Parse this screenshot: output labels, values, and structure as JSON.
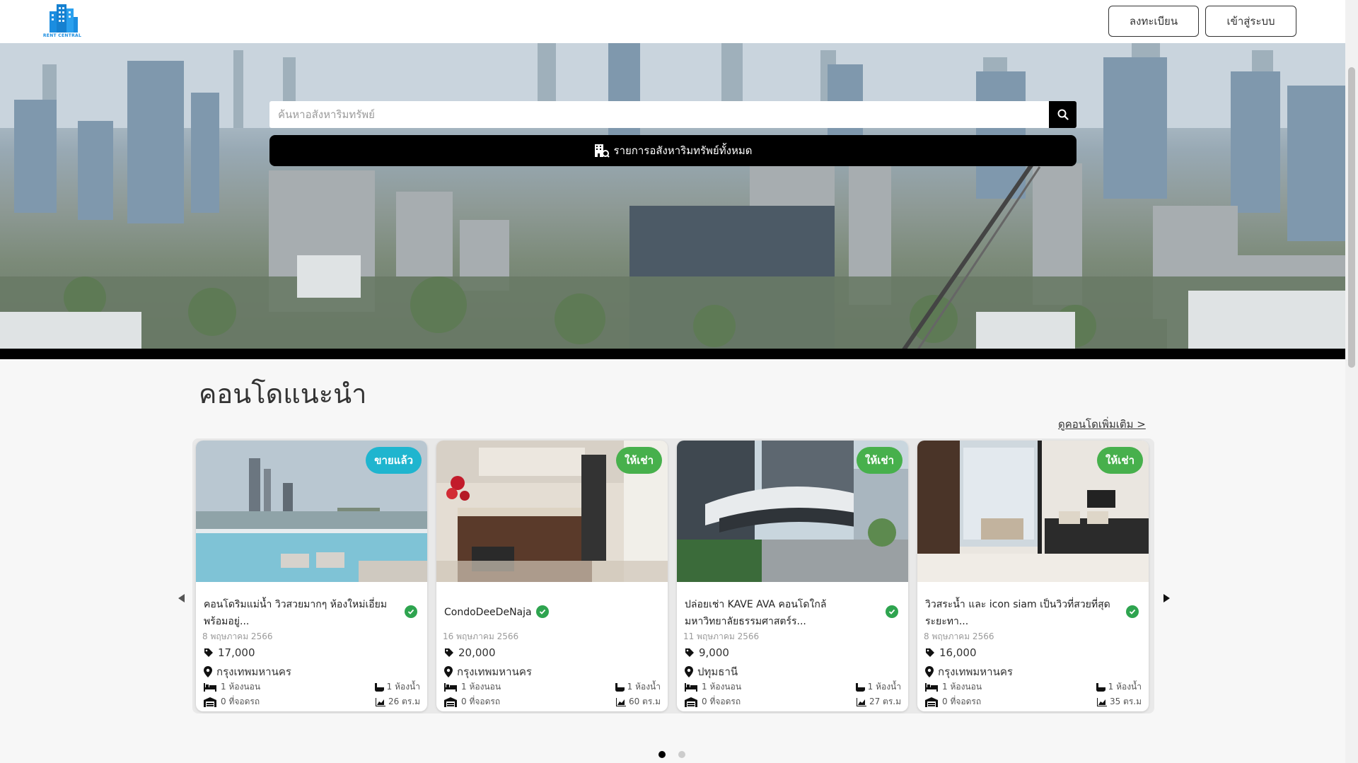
{
  "header": {
    "logo_text": "RENT CENTRAL",
    "register_label": "ลงทะเบียน",
    "login_label": "เข้าสู่ระบบ"
  },
  "hero": {
    "search_placeholder": "ค้นหาอสังหาริมทรัพย์",
    "all_listings_label": "รายการอสังหาริมทรัพย์ทั้งหมด"
  },
  "section": {
    "title": "คอนโดแนะนำ",
    "see_more": "ดูคอนโดเพิ่มเติม >"
  },
  "cards": [
    {
      "badge": "ขายแล้ว",
      "badge_type": "sold",
      "title": "คอนโดริมแม่น้ำ วิวสวยมากๆ ห้องใหม่เอี่ยม พร้อมอยู่...",
      "date": "8 พฤษภาคม 2566",
      "price": "17,000",
      "province": "กรุงเทพมหานคร",
      "bedrooms": "1 ห้องนอน",
      "bathrooms": "1 ห้องน้ำ",
      "parking": "0 ที่จอดรถ",
      "area": "26 ตร.ม"
    },
    {
      "badge": "ให้เช่า",
      "badge_type": "rent",
      "title": "CondoDeeDeNaja",
      "date": "16 พฤษภาคม 2566",
      "price": "20,000",
      "province": "กรุงเทพมหานคร",
      "bedrooms": "1 ห้องนอน",
      "bathrooms": "1 ห้องน้ำ",
      "parking": "0 ที่จอดรถ",
      "area": "60 ตร.ม"
    },
    {
      "badge": "ให้เช่า",
      "badge_type": "rent",
      "title": "ปล่อยเช่า KAVE AVA คอนโดใกล้มหาวิทยาลัยธรรมศาสตร์ร...",
      "date": "11 พฤษภาคม 2566",
      "price": "9,000",
      "province": "ปทุมธานี",
      "bedrooms": "1 ห้องนอน",
      "bathrooms": "1 ห้องน้ำ",
      "parking": "0 ที่จอดรถ",
      "area": "27 ตร.ม"
    },
    {
      "badge": "ให้เช่า",
      "badge_type": "rent",
      "title": "วิวสระน้ำ และ icon siam เป็นวิวที่สวยที่สุดระยะทา...",
      "date": "8 พฤษภาคม 2566",
      "price": "16,000",
      "province": "กรุงเทพมหานคร",
      "bedrooms": "1 ห้องนอน",
      "bathrooms": "1 ห้องน้ำ",
      "parking": "0 ที่จอดรถ",
      "area": "35 ตร.ม"
    }
  ],
  "carousel": {
    "pages": 2,
    "active_page": 1
  },
  "colors": {
    "sold_badge": "#1fb5cf",
    "rent_badge": "#47b04c",
    "verified": "#2ea44f",
    "logo": "#1b8de0"
  }
}
